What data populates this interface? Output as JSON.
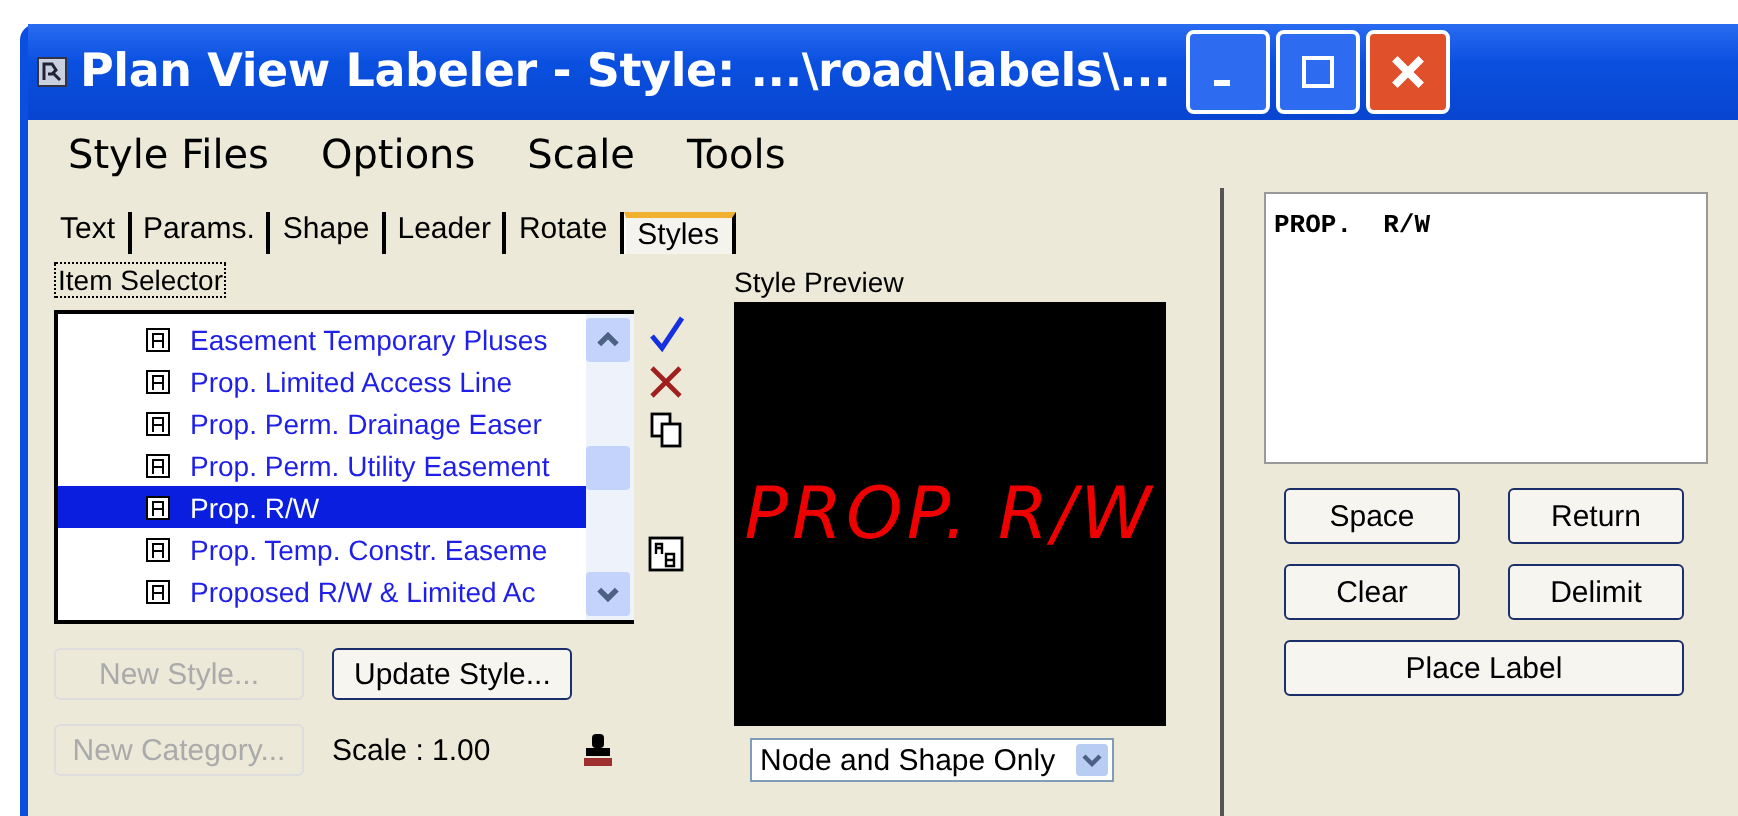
{
  "window": {
    "title": "Plan View Labeler - Style: ...\\road\\labels\\..."
  },
  "menu": [
    "Style Files",
    "Options",
    "Scale",
    "Tools"
  ],
  "tabs": [
    {
      "label": "Text",
      "selected": false
    },
    {
      "label": "Params.",
      "selected": false
    },
    {
      "label": "Shape",
      "selected": false
    },
    {
      "label": "Leader",
      "selected": false
    },
    {
      "label": "Rotate",
      "selected": false
    },
    {
      "label": "Styles",
      "selected": true
    }
  ],
  "item_selector": {
    "label": "Item Selector",
    "items": [
      {
        "label": "Easement Temporary Pluses",
        "selected": false
      },
      {
        "label": "Prop.  Limited  Access  Line",
        "selected": false
      },
      {
        "label": "Prop. Perm. Drainage Easer",
        "selected": false
      },
      {
        "label": "Prop. Perm. Utility Easement",
        "selected": false
      },
      {
        "label": "Prop. R/W",
        "selected": true
      },
      {
        "label": "Prop. Temp. Constr. Easeme",
        "selected": false
      },
      {
        "label": "Proposed R/W & Limited Ac",
        "selected": false
      }
    ]
  },
  "style_buttons": [
    {
      "label": "New Style...",
      "disabled": true
    },
    {
      "label": "Update Style...",
      "disabled": false
    }
  ],
  "category_button": {
    "label": "New Category...",
    "disabled": true
  },
  "scale": "Scale : 1.00",
  "preview": {
    "label": "Style Preview",
    "text": "PROP. R/W",
    "mode": "Node and Shape Only"
  },
  "label_text": "PROP.  R/W",
  "buttons": [
    "Space",
    "Return",
    "Clear",
    "Delimit"
  ],
  "place_button": "Place Label"
}
